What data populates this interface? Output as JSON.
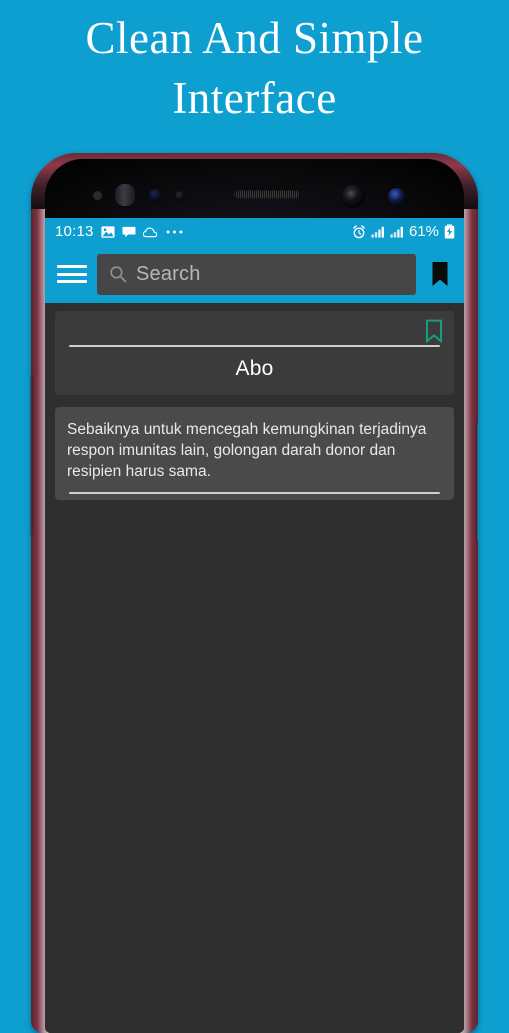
{
  "promo": {
    "title": "Clean And Simple\nInterface"
  },
  "theme": {
    "background": "#0d9fd0",
    "accent": "#0d9fd0",
    "screen_bg": "#2f2f2f",
    "card_bg": "#3b3b3b",
    "bookmark_teal": "#1a9c80"
  },
  "status_bar": {
    "clock": "10:13",
    "left_icons": [
      "image-icon",
      "message-icon",
      "cloud-icon",
      "more-dots-icon"
    ],
    "alarm_icon": "alarm-icon",
    "signal_icons": [
      "signal-bars-icon",
      "signal-bars-icon"
    ],
    "battery_percent": "61%",
    "battery_icon": "battery-charging-icon"
  },
  "app_bar": {
    "menu_icon": "hamburger-menu-icon",
    "search": {
      "placeholder": "Search",
      "value": "",
      "icon": "search-icon"
    },
    "bookmark_icon": "bookmark-filled-icon"
  },
  "content": {
    "cards": [
      {
        "bookmark_icon": "bookmark-outline-icon",
        "title": "Abo"
      },
      {
        "text": "Sebaiknya untuk mencegah kemungkinan terjadinya respon imunitas lain, golongan darah donor dan resipien harus sama."
      }
    ]
  },
  "device": {
    "volume_button": "volume-button",
    "power_button": "power-button"
  }
}
